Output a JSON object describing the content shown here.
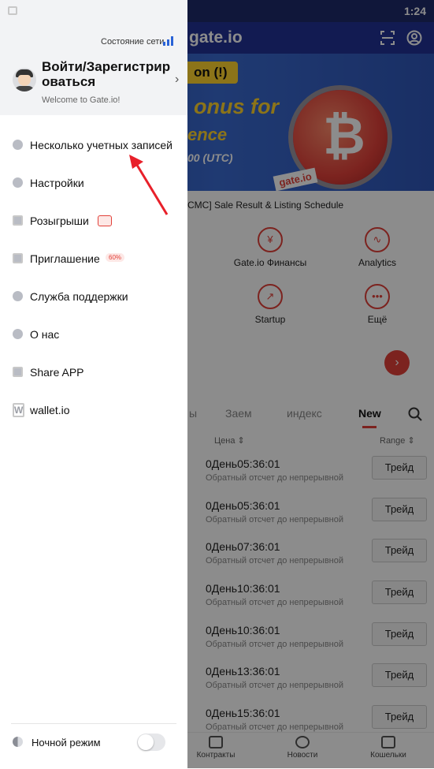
{
  "status_bar": {
    "time": "1:24"
  },
  "app": {
    "logo": "gate.io",
    "banner": {
      "pill": "on (!)",
      "bonus_line1": "onus for",
      "bonus_line2": "ence",
      "bonus_line3": "00 (UTC)",
      "tag": "gate.io"
    },
    "ticker": {
      "text": "CMC] Sale Result & Listing Schedule"
    },
    "shortcuts": [
      {
        "label": "Gate.io Финансы",
        "icon": "piggy-bank-icon"
      },
      {
        "label": "Analytics",
        "icon": "pulse-icon"
      },
      {
        "label": "Startup",
        "icon": "rocket-icon"
      },
      {
        "label": "Ещё",
        "icon": "more-dots-icon"
      }
    ],
    "tabs": {
      "partial": "ы",
      "loan": "Заем",
      "index": "индекс",
      "new": "New"
    },
    "columns": {
      "price": "Цена ⇕",
      "range": "Range ⇕"
    },
    "rows": [
      {
        "time": "0День05:36:01",
        "sub": "Обратный отсчет до непрерывной",
        "btn": "Трейд"
      },
      {
        "time": "0День05:36:01",
        "sub": "Обратный отсчет до непрерывной",
        "btn": "Трейд"
      },
      {
        "time": "0День07:36:01",
        "sub": "Обратный отсчет до непрерывной",
        "btn": "Трейд"
      },
      {
        "time": "0День10:36:01",
        "sub": "Обратный отсчет до непрерывной",
        "btn": "Трейд"
      },
      {
        "time": "0День10:36:01",
        "sub": "Обратный отсчет до непрерывной",
        "btn": "Трейд"
      },
      {
        "time": "0День13:36:01",
        "sub": "Обратный отсчет до непрерывной",
        "btn": "Трейд"
      },
      {
        "time": "0День15:36:01",
        "sub": "Обратный отсчет до непрерывной",
        "btn": "Трейд"
      }
    ],
    "bottom_nav": [
      {
        "label": "Контракты"
      },
      {
        "label": "Новости"
      },
      {
        "label": "Кошельки"
      }
    ]
  },
  "drawer": {
    "network_label": "Состояние сети",
    "login_title": "Войти/Зарегистрир оваться",
    "welcome": "Welcome to Gate.io!",
    "menu": [
      {
        "label": "Несколько учетных записей",
        "icon": "accounts-icon"
      },
      {
        "label": "Настройки",
        "icon": "settings-icon"
      },
      {
        "label": "Розыгрыши",
        "icon": "lottery-icon"
      },
      {
        "label": "Приглашение",
        "icon": "gift-icon"
      },
      {
        "label": "Служба поддержки",
        "icon": "help-icon"
      },
      {
        "label": "О нас",
        "icon": "about-icon"
      },
      {
        "label": "Share APP",
        "icon": "share-icon"
      },
      {
        "label": "wallet.io",
        "icon": "wallet-io-icon"
      }
    ],
    "invite_badge": "60%",
    "night_mode": "Ночной режим"
  },
  "colors": {
    "brand_blue": "#213296",
    "accent_red": "#e2413a",
    "arrow_red": "#e8202a"
  }
}
